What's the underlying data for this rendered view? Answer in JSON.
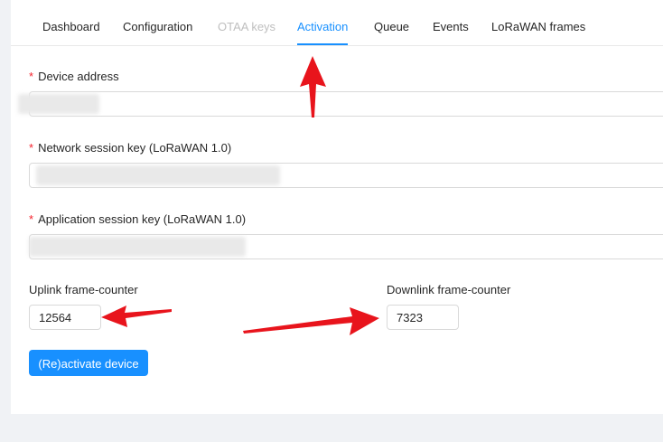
{
  "tabs": [
    {
      "label": "Dashboard",
      "state": "normal"
    },
    {
      "label": "Configuration",
      "state": "normal"
    },
    {
      "label": "OTAA keys",
      "state": "disabled"
    },
    {
      "label": "Activation",
      "state": "active"
    },
    {
      "label": "Queue",
      "state": "normal"
    },
    {
      "label": "Events",
      "state": "normal"
    },
    {
      "label": "LoRaWAN frames",
      "state": "normal"
    }
  ],
  "form": {
    "required_mark": "*",
    "device_address": {
      "label": "Device address",
      "value": ""
    },
    "nwk_s_key": {
      "label": "Network session key (LoRaWAN 1.0)",
      "value": ""
    },
    "app_s_key": {
      "label": "Application session key (LoRaWAN 1.0)",
      "value": ""
    },
    "uplink_counter": {
      "label": "Uplink frame-counter",
      "value": "12564"
    },
    "downlink_counter": {
      "label": "Downlink frame-counter",
      "value": "7323"
    },
    "submit_label": "(Re)activate device"
  },
  "colors": {
    "accent": "#1890ff",
    "annotation_arrow": "#e8141c",
    "required": "#f5222d"
  }
}
